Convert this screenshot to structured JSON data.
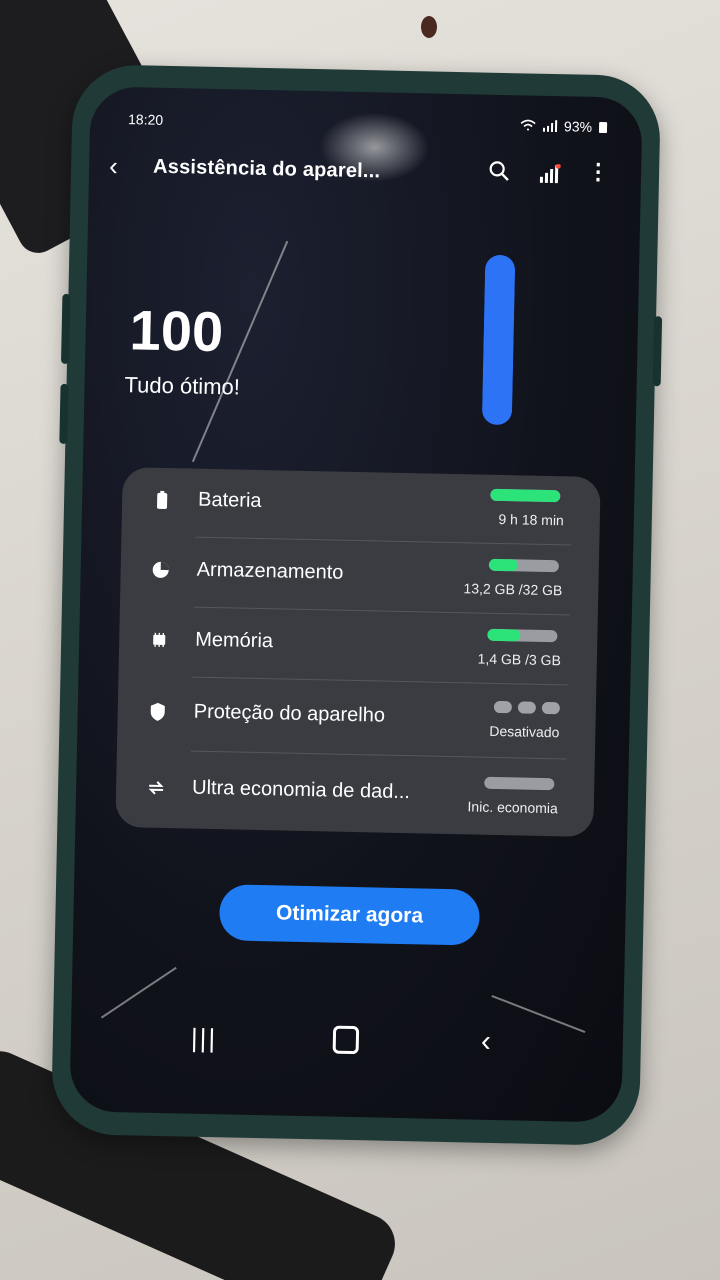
{
  "status_bar": {
    "time": "18:20",
    "battery": "93%"
  },
  "toolbar": {
    "title": "Assistência do aparel..."
  },
  "score": {
    "value": "100",
    "status": "Tudo ótimo!",
    "level_fraction": 1.0
  },
  "items": [
    {
      "label": "Bateria",
      "value": "9 h 18 min",
      "fill": 1.0,
      "icon": "battery-icon"
    },
    {
      "label": "Armazenamento",
      "value": "13,2 GB /32 GB",
      "fill": 0.41,
      "icon": "storage-icon"
    },
    {
      "label": "Memória",
      "value": "1,4 GB /3 GB",
      "fill": 0.47,
      "icon": "memory-icon"
    },
    {
      "label": "Proteção do aparelho",
      "value": "Desativado",
      "fill": 0,
      "icon": "shield-icon"
    },
    {
      "label": "Ultra economia de dad...",
      "value": "Inic. economia",
      "fill": 0,
      "icon": "data-saver-icon"
    }
  ],
  "optimize_button": {
    "label": "Otimizar agora"
  },
  "colors": {
    "accent": "#1f7cf2",
    "bar_green": "#2ce37a",
    "score_bar": "#2d73f5"
  }
}
